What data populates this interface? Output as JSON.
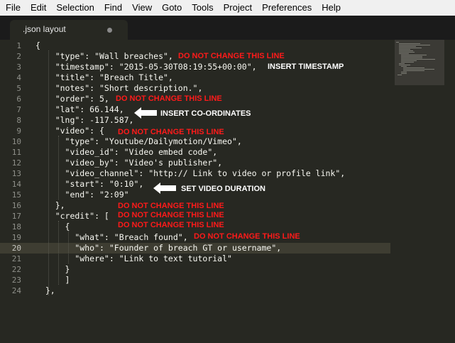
{
  "menu": [
    "File",
    "Edit",
    "Selection",
    "Find",
    "View",
    "Goto",
    "Tools",
    "Project",
    "Preferences",
    "Help"
  ],
  "tab": {
    "title": ".json layout"
  },
  "editor": {
    "current_line": 20,
    "lines": [
      {
        "n": "1",
        "text": "{"
      },
      {
        "n": "2",
        "text": "    \"type\": \"Wall breaches\","
      },
      {
        "n": "3",
        "text": "    \"timestamp\": \"2015-05-30T08:19:55+00:00\","
      },
      {
        "n": "4",
        "text": "    \"title\": \"Breach Title\","
      },
      {
        "n": "5",
        "text": "    \"notes\": \"Short description.\","
      },
      {
        "n": "6",
        "text": "    \"order\": 5,"
      },
      {
        "n": "7",
        "text": "    \"lat\": 66.144,"
      },
      {
        "n": "8",
        "text": "    \"lng\": -117.587,"
      },
      {
        "n": "9",
        "text": "    \"video\": {"
      },
      {
        "n": "10",
        "text": "      \"type\": \"Youtube/Dailymotion/Vimeo\","
      },
      {
        "n": "11",
        "text": "      \"video_id\": \"Video embed code\","
      },
      {
        "n": "12",
        "text": "      \"video_by\": \"Video's publisher\","
      },
      {
        "n": "13",
        "text": "      \"video_channel\": \"http:// Link to video or profile link\","
      },
      {
        "n": "14",
        "text": "      \"start\": \"0:10\","
      },
      {
        "n": "15",
        "text": "      \"end\": \"2:09\""
      },
      {
        "n": "16",
        "text": "    },"
      },
      {
        "n": "17",
        "text": "    \"credit\": ["
      },
      {
        "n": "18",
        "text": "      {"
      },
      {
        "n": "19",
        "text": "        \"what\": \"Breach found\","
      },
      {
        "n": "20",
        "text": "        \"who\": \"Founder of breach GT or username\","
      },
      {
        "n": "21",
        "text": "        \"where\": \"Link to text tutorial\""
      },
      {
        "n": "22",
        "text": "      }"
      },
      {
        "n": "23",
        "text": "      ]"
      },
      {
        "n": "24",
        "text": "  },"
      }
    ]
  },
  "annotations": {
    "type_line": "DO NOT CHANGE THIS LINE",
    "timestamp": "INSERT TIMESTAMP",
    "order_line": "DO NOT CHANGE THIS LINE",
    "coords": "INSERT CO-ORDINATES",
    "video_line": "DO NOT CHANGE THIS LINE",
    "duration": "SET VIDEO DURATION",
    "close_line": "DO NOT CHANGE THIS LINE",
    "credit_line": "DO NOT CHANGE THIS LINE",
    "brace_line": "DO NOT CHANGE THIS LINE",
    "what_line": "DO NOT CHANGE THIS LINE"
  },
  "colors": {
    "annotation_red": "#ff1a1a",
    "annotation_white": "#ffffff",
    "editor_bg": "#272822"
  }
}
